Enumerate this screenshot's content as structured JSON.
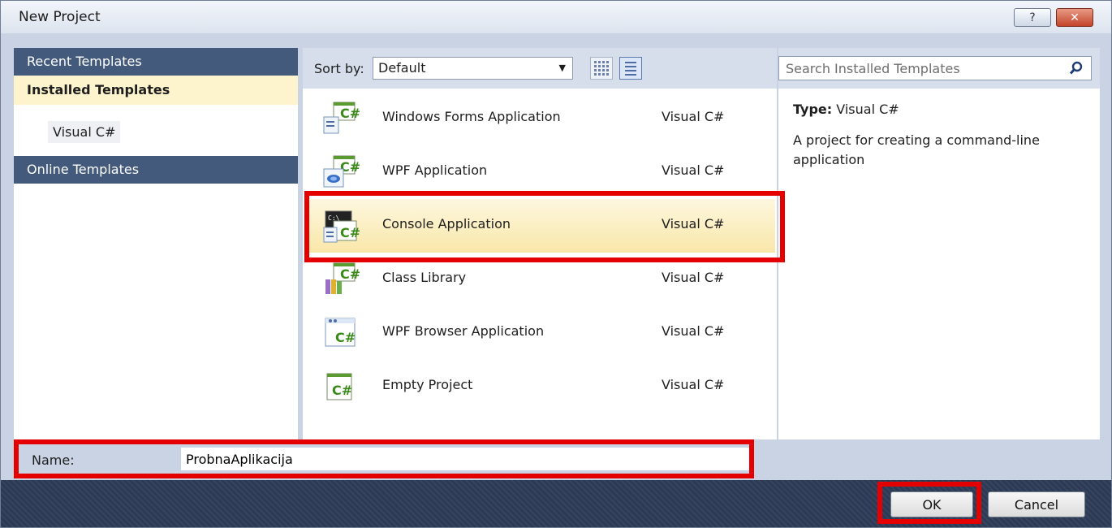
{
  "window": {
    "title": "New Project",
    "help_label": "?",
    "close_label": "✕"
  },
  "sidebar": {
    "recent": "Recent Templates",
    "installed": "Installed Templates",
    "installed_child": "Visual C#",
    "online": "Online Templates"
  },
  "toolbar": {
    "sort_label": "Sort by:",
    "sort_value": "Default"
  },
  "templates": [
    {
      "name": "Windows Forms Application",
      "lang": "Visual C#",
      "icon": "windows-forms-csharp-icon"
    },
    {
      "name": "WPF Application",
      "lang": "Visual C#",
      "icon": "wpf-csharp-icon"
    },
    {
      "name": "Console Application",
      "lang": "Visual C#",
      "icon": "console-csharp-icon",
      "selected": true
    },
    {
      "name": "Class Library",
      "lang": "Visual C#",
      "icon": "class-library-csharp-icon"
    },
    {
      "name": "WPF Browser Application",
      "lang": "Visual C#",
      "icon": "wpf-browser-csharp-icon"
    },
    {
      "name": "Empty Project",
      "lang": "Visual C#",
      "icon": "empty-project-csharp-icon"
    }
  ],
  "search": {
    "placeholder": "Search Installed Templates"
  },
  "details": {
    "type_label": "Type:",
    "type_value": "Visual C#",
    "description": "A project for creating a command-line application"
  },
  "name_field": {
    "label": "Name:",
    "value": "ProbnaAplikacija"
  },
  "buttons": {
    "ok": "OK",
    "cancel": "Cancel"
  },
  "colors": {
    "header": "#445a7d",
    "selected_row": "#f9e7a9",
    "highlight": "#e50000",
    "footer": "#2c3a55"
  }
}
